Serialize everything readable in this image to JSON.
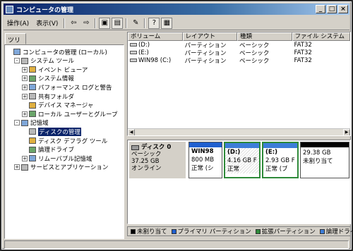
{
  "window": {
    "title": "コンピュータの管理"
  },
  "menu": {
    "action": "操作(A)",
    "view": "表示(V)"
  },
  "colors": {
    "primary": "#1f5fcf",
    "extended": "#2f8a3a",
    "unallocated": "#000000",
    "logical": "#3c7dd8",
    "selection": "#0a246a"
  },
  "tree": {
    "tab": "ツリー",
    "nodes": [
      {
        "label": "コンピュータの管理 (ローカル)",
        "level": 0,
        "expander": "",
        "icon": "computer-icon"
      },
      {
        "label": "システム ツール",
        "level": 1,
        "expander": "-",
        "icon": "tools-icon"
      },
      {
        "label": "イベント ビューア",
        "level": 2,
        "expander": "+",
        "icon": "event-viewer-icon"
      },
      {
        "label": "システム情報",
        "level": 2,
        "expander": "+",
        "icon": "system-info-icon"
      },
      {
        "label": "パフォーマンス ログと警告",
        "level": 2,
        "expander": "+",
        "icon": "performance-icon"
      },
      {
        "label": "共有フォルダ",
        "level": 2,
        "expander": "+",
        "icon": "shared-folder-icon"
      },
      {
        "label": "デバイス マネージャ",
        "level": 2,
        "expander": "",
        "icon": "device-manager-icon"
      },
      {
        "label": "ローカル ユーザーとグループ",
        "level": 2,
        "expander": "+",
        "icon": "users-icon"
      },
      {
        "label": "記憶域",
        "level": 1,
        "expander": "-",
        "icon": "storage-icon"
      },
      {
        "label": "ディスクの管理",
        "level": 2,
        "expander": "",
        "icon": "disk-management-icon",
        "selected": true
      },
      {
        "label": "ディスク デフラグ ツール",
        "level": 2,
        "expander": "",
        "icon": "defrag-icon"
      },
      {
        "label": "論理ドライブ",
        "level": 2,
        "expander": "",
        "icon": "logical-drive-icon"
      },
      {
        "label": "リムーバブル記憶域",
        "level": 2,
        "expander": "+",
        "icon": "removable-storage-icon"
      },
      {
        "label": "サービスとアプリケーション",
        "level": 1,
        "expander": "+",
        "icon": "services-icon"
      }
    ]
  },
  "volumes": {
    "headers": [
      "ボリューム",
      "レイアウト",
      "種類",
      "ファイル システム"
    ],
    "rows": [
      [
        "(D:)",
        "パーティション",
        "ベーシック",
        "FAT32"
      ],
      [
        "(E:)",
        "パーティション",
        "ベーシック",
        "FAT32"
      ],
      [
        "WIN98 (C:)",
        "パーティション",
        "ベーシック",
        "FAT32"
      ]
    ]
  },
  "disk": {
    "name": "ディスク 0",
    "type": "ベーシック",
    "size": "37.25 GB",
    "status": "オンライン",
    "partitions": [
      {
        "line1": "WIN98",
        "line2": "800 MB",
        "line3": "正常 (シ",
        "kind": "primary"
      },
      {
        "line1": "(D:)",
        "line2": "4.16 GB F",
        "line3": "正常",
        "kind": "logical",
        "selected": true
      },
      {
        "line1": "(E:)",
        "line2": "2.93 GB F",
        "line3": "正常 (ブ",
        "kind": "logical"
      },
      {
        "line1": "",
        "line2": "29.38 GB",
        "line3": "未割り当て",
        "kind": "unallocated"
      }
    ]
  },
  "legend": [
    {
      "label": "未割り当て",
      "color": "#000000"
    },
    {
      "label": "プライマリ パーティション",
      "color": "#1f5fcf"
    },
    {
      "label": "拡張パーティション",
      "color": "#2f8a3a"
    },
    {
      "label": "論理ドライブ",
      "color": "#3c7dd8"
    }
  ]
}
